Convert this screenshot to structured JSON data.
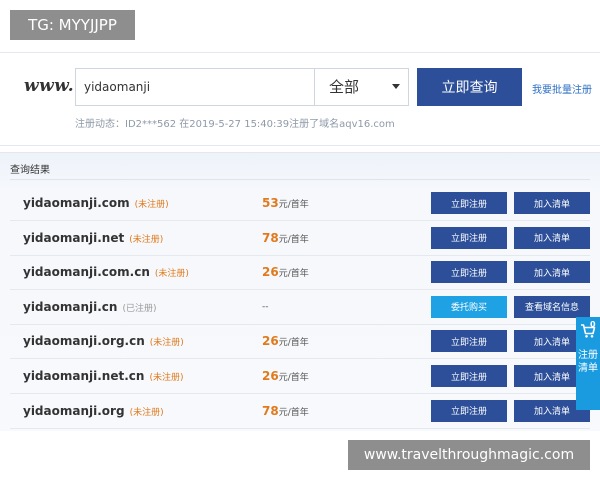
{
  "badge": "TG: MYYJJPP",
  "search": {
    "logo": "www.",
    "value": "yidaomanji",
    "scope": "全部",
    "button": "立即查询",
    "bulk_link": "我要批量注册",
    "notice": "注册动态：ID2***562 在2019-5-27 15:40:39注册了域名aqv16.com"
  },
  "results": {
    "heading": "查询结果",
    "rows": [
      {
        "domain": "yidaomanji.com",
        "status": "(未注册)",
        "price": "53",
        "unit": "元/首年",
        "btn1": "立即注册",
        "btn2": "加入清单"
      },
      {
        "domain": "yidaomanji.net",
        "status": "(未注册)",
        "price": "78",
        "unit": "元/首年",
        "btn1": "立即注册",
        "btn2": "加入清单"
      },
      {
        "domain": "yidaomanji.com.cn",
        "status": "(未注册)",
        "price": "26",
        "unit": "元/首年",
        "btn1": "立即注册",
        "btn2": "加入清单"
      },
      {
        "domain": "yidaomanji.cn",
        "status": "(已注册)",
        "price": "--",
        "unit": "",
        "btn1": "委托购买",
        "btn2": "查看域名信息"
      },
      {
        "domain": "yidaomanji.org.cn",
        "status": "(未注册)",
        "price": "26",
        "unit": "元/首年",
        "btn1": "立即注册",
        "btn2": "加入清单"
      },
      {
        "domain": "yidaomanji.net.cn",
        "status": "(未注册)",
        "price": "26",
        "unit": "元/首年",
        "btn1": "立即注册",
        "btn2": "加入清单"
      },
      {
        "domain": "yidaomanji.org",
        "status": "(未注册)",
        "price": "78",
        "unit": "元/首年",
        "btn1": "立即注册",
        "btn2": "加入清单"
      }
    ]
  },
  "cart": {
    "count": "0",
    "label": "注册清单",
    "icon": "cart-icon"
  },
  "watermark": "www.travelthroughmagic.com",
  "colors": {
    "navy": "#2d4f99",
    "light_blue": "#1fa2e3",
    "orange": "#e07a1c"
  }
}
